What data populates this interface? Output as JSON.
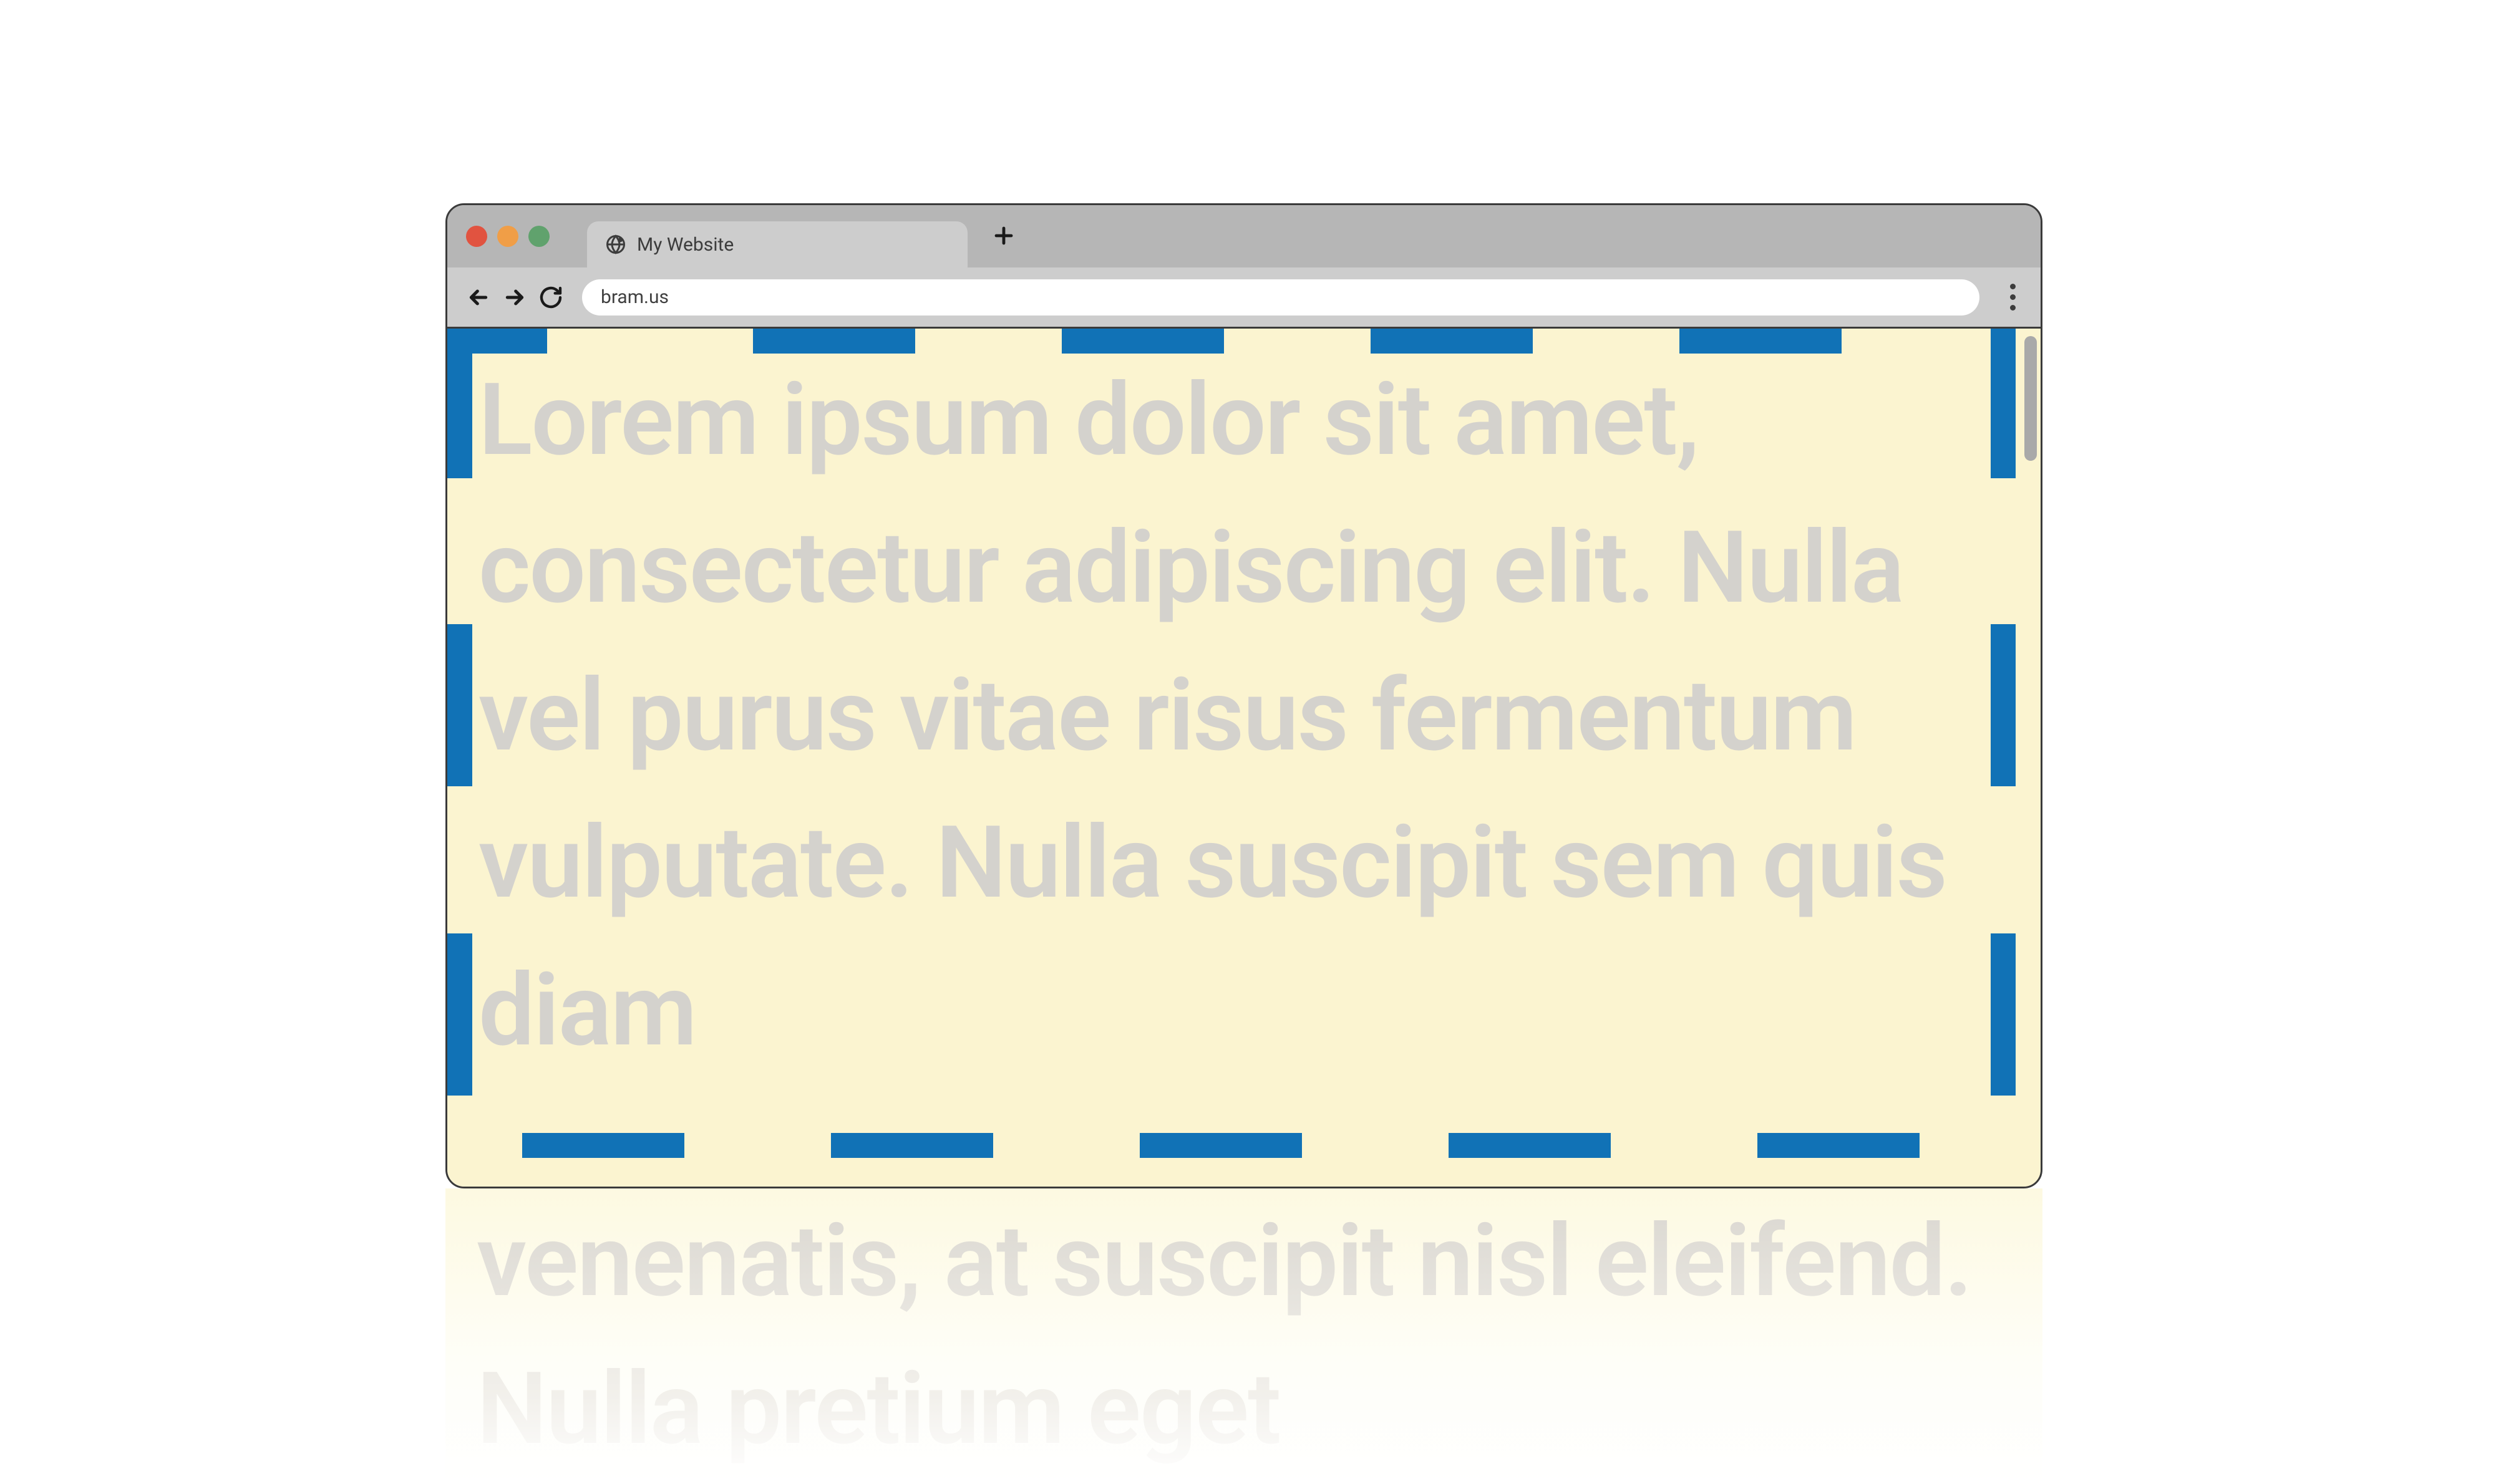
{
  "browser": {
    "tab": {
      "title": "My Website"
    },
    "url": "bram.us"
  },
  "page": {
    "paragraph": "Lorem ipsum dolor sit amet, consectetur adipiscing elit. Nulla vel purus vitae risus fermentum vulputate. Nulla suscipit sem quis diam",
    "overflow_text": "venenatis, at suscipit nisl eleifend. Nulla pretium eget"
  },
  "colors": {
    "dash": "#1172b6",
    "page_bg": "#fbf4d0",
    "text": "#d4d2cd"
  }
}
